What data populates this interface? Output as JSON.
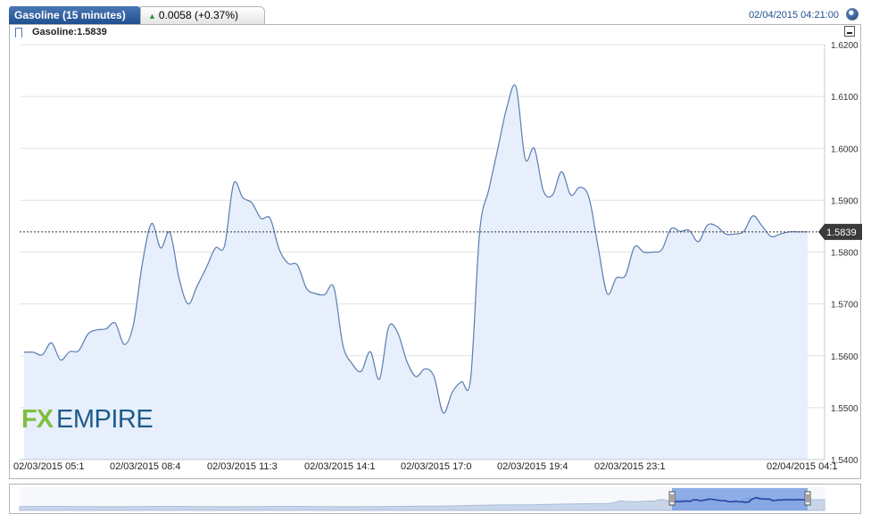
{
  "header": {
    "tab_title": "Gasoline (15 minutes)",
    "change_text": "0.0058 (+0.37%)",
    "timestamp": "02/04/2015 04:21:00"
  },
  "legend": {
    "label": "Gasoline:1.5839"
  },
  "watermark": {
    "text_fx": "FX",
    "text_empire": "EMPIRE"
  },
  "colors": {
    "line": "#5a7db1",
    "fill": "#e6effb",
    "tab": "#2a5a9a",
    "up": "#2a9a2a",
    "logo_green": "#7fbf3f",
    "logo_blue": "#1e5b8c"
  },
  "chart_data": {
    "type": "area",
    "title": "",
    "xlabel": "",
    "ylabel": "",
    "ylim": [
      1.54,
      1.62
    ],
    "y_ticks": [
      "1.5400",
      "1.5500",
      "1.5600",
      "1.5700",
      "1.5800",
      "1.5900",
      "1.6000",
      "1.6100",
      "1.6200"
    ],
    "x_tick_labels": [
      "02/03/2015 05:1",
      "02/03/2015 08:4",
      "02/03/2015 11:3",
      "02/03/2015 14:1",
      "02/03/2015 17:0",
      "02/03/2015 19:4",
      "02/03/2015 23:1",
      "02/04/2015 04:1"
    ],
    "last_value": 1.5839,
    "last_value_label": "1.5839",
    "grid": true,
    "series": [
      {
        "values": [
          1.5607,
          1.5607,
          1.5602,
          1.5625,
          1.5592,
          1.5608,
          1.561,
          1.5642,
          1.565,
          1.5652,
          1.5663,
          1.5622,
          1.566,
          1.578,
          1.5855,
          1.5808,
          1.5838,
          1.575,
          1.57,
          1.5735,
          1.577,
          1.5808,
          1.5812,
          1.5932,
          1.5905,
          1.5895,
          1.5865,
          1.5865,
          1.5805,
          1.5778,
          1.5775,
          1.573,
          1.572,
          1.5718,
          1.5732,
          1.562,
          1.5585,
          1.557,
          1.5608,
          1.5555,
          1.5655,
          1.5645,
          1.559,
          1.556,
          1.5575,
          1.556,
          1.549,
          1.553,
          1.555,
          1.5555,
          1.584,
          1.592,
          1.6,
          1.608,
          1.6118,
          1.598,
          1.6,
          1.5918,
          1.591,
          1.5955,
          1.591,
          1.5925,
          1.5905,
          1.581,
          1.572,
          1.575,
          1.5755,
          1.581,
          1.58,
          1.58,
          1.5805,
          1.5845,
          1.584,
          1.5842,
          1.582,
          1.5852,
          1.585,
          1.5835,
          1.5835,
          1.584,
          1.587,
          1.585,
          1.583,
          1.5835,
          1.5839,
          1.5839,
          1.5839
        ]
      }
    ]
  }
}
